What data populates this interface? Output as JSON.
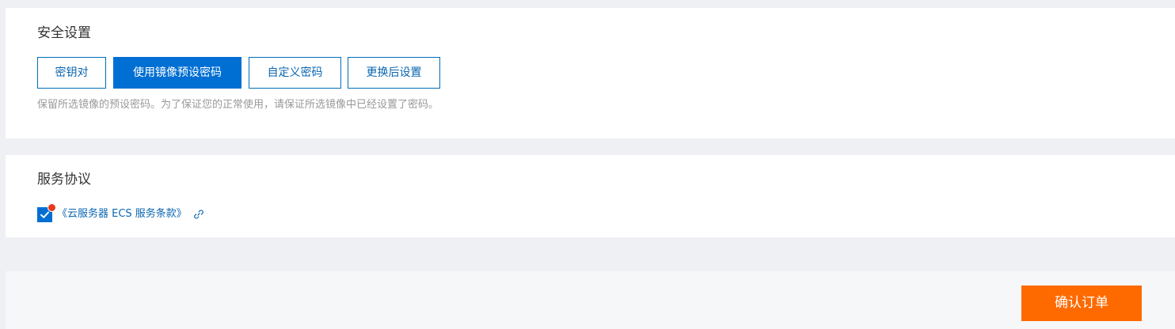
{
  "security": {
    "title": "安全设置",
    "options": [
      {
        "label": "密钥对",
        "selected": false
      },
      {
        "label": "使用镜像预设密码",
        "selected": true
      },
      {
        "label": "自定义密码",
        "selected": false
      },
      {
        "label": "更换后设置",
        "selected": false
      }
    ],
    "hint": "保留所选镜像的预设密码。为了保证您的正常使用，请保证所选镜像中已经设置了密码。"
  },
  "agreement": {
    "title": "服务协议",
    "checked": true,
    "link_text": "《云服务器 ECS 服务条款》",
    "link_icon": "link-icon"
  },
  "footer": {
    "confirm_label": "确认订单"
  },
  "colors": {
    "primary_blue": "#006fd3",
    "link_blue": "#0a66b0",
    "confirm_orange": "#ff6a00",
    "badge_red": "#e63a1e",
    "page_bg": "#eff0f3"
  }
}
